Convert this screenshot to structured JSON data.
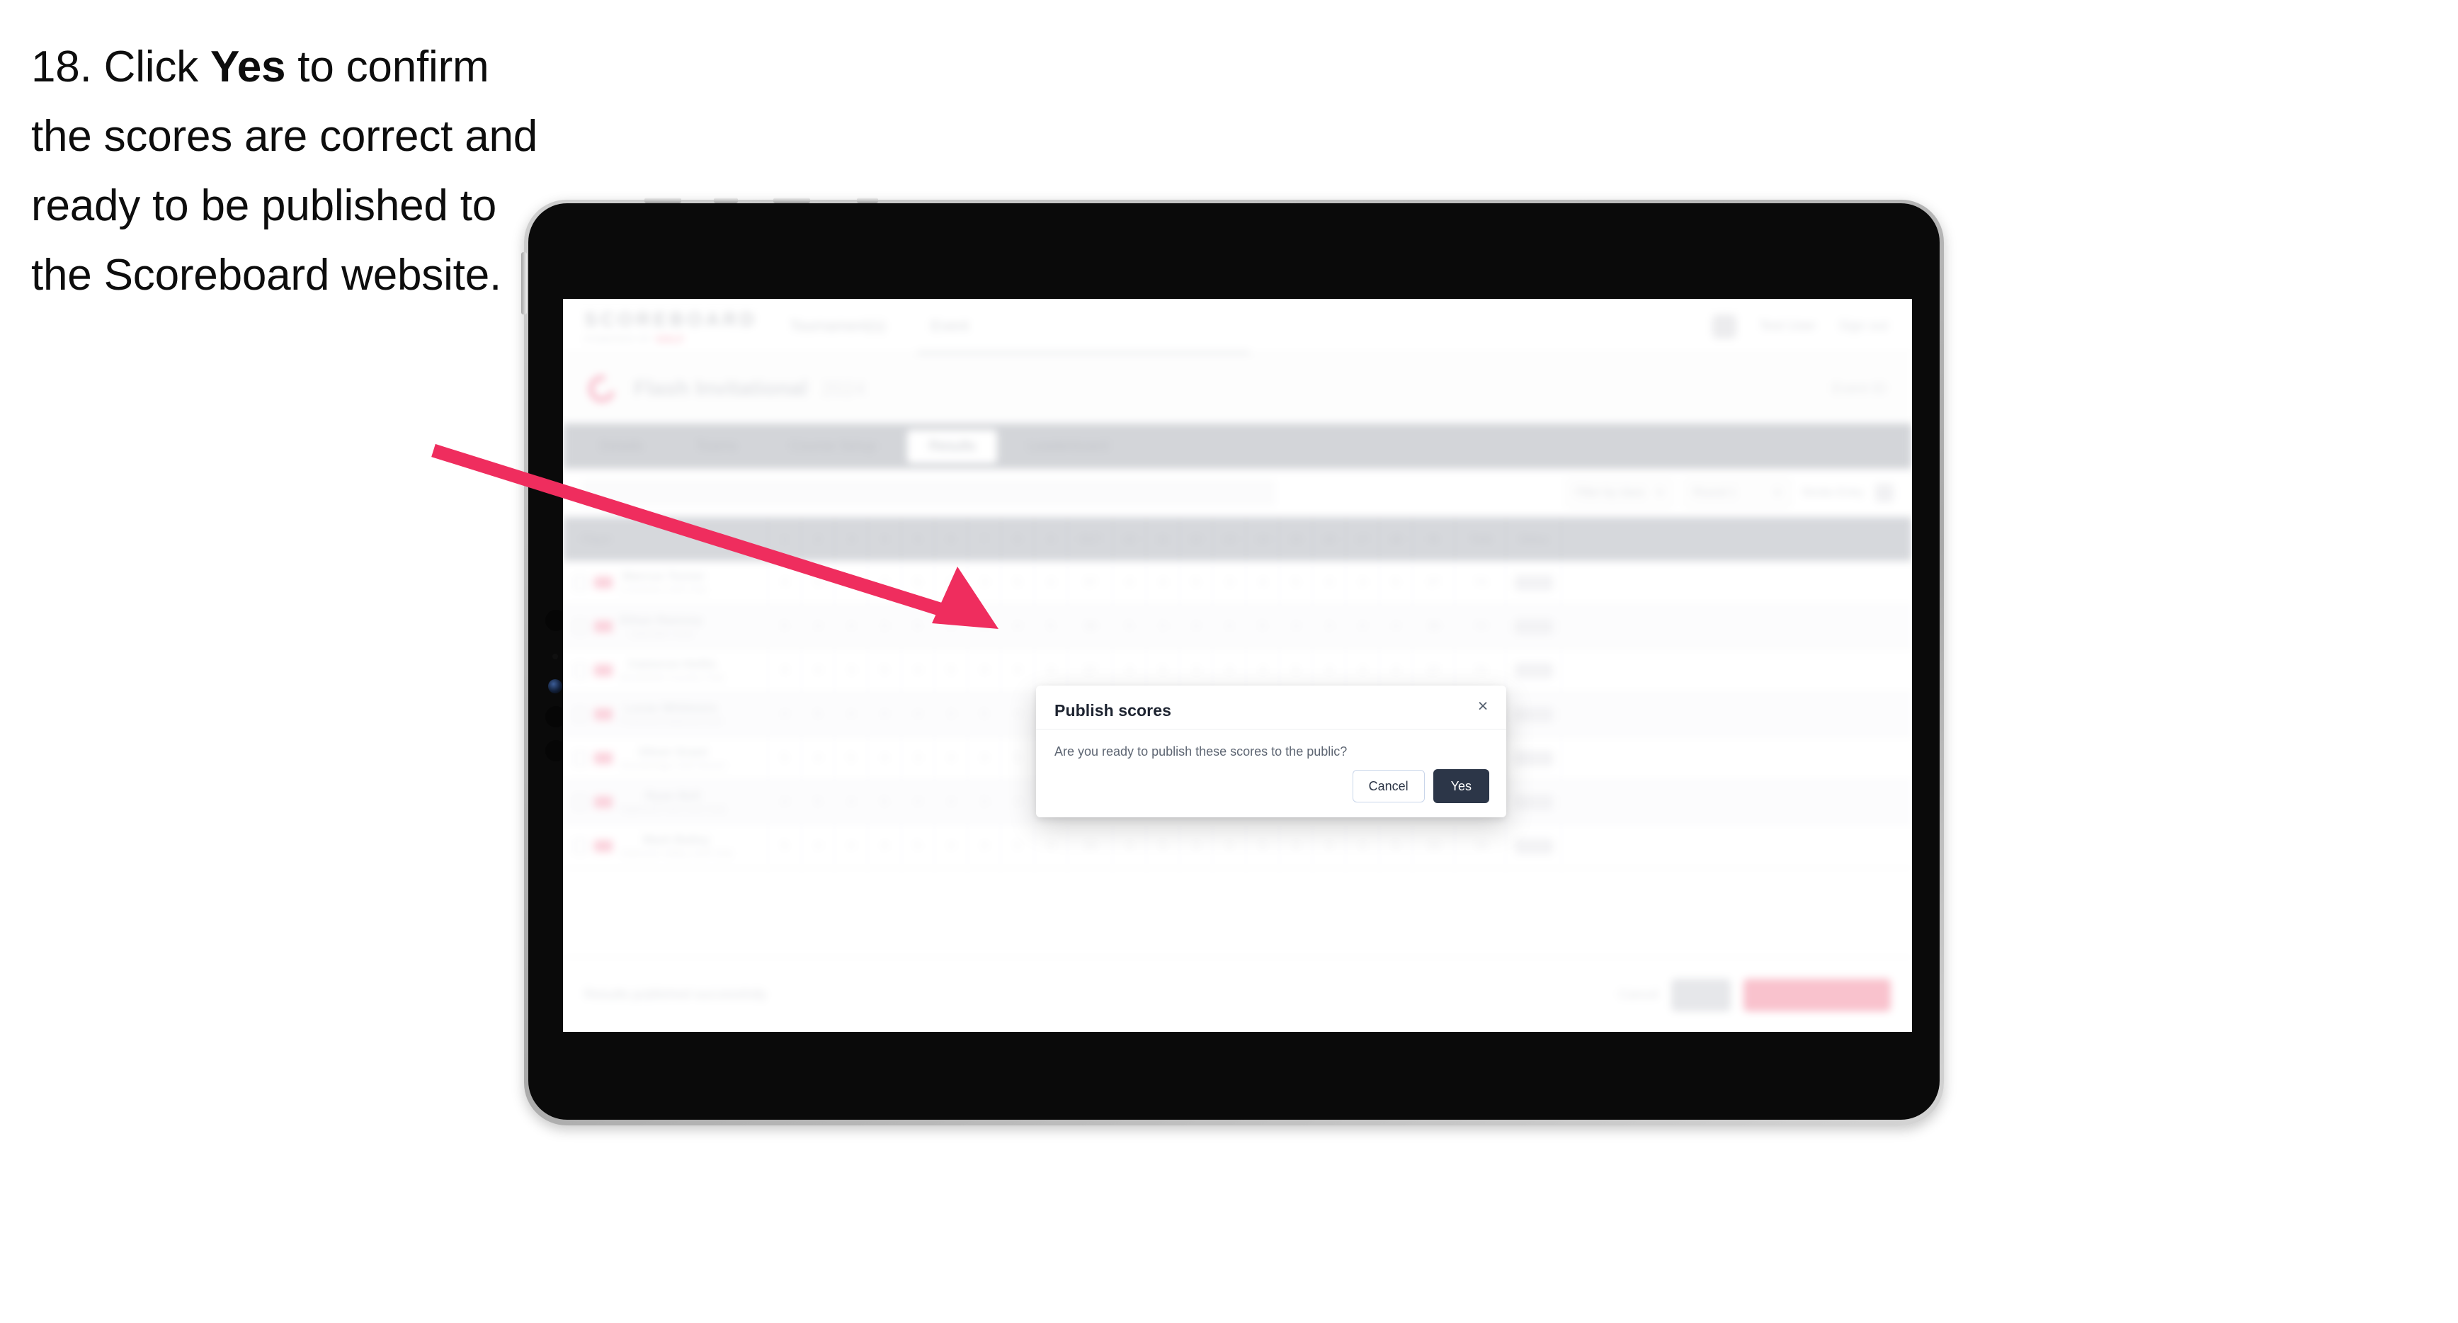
{
  "instruction": {
    "prefix": "18. Click ",
    "emphasis": "Yes",
    "suffix": " to confirm the scores are correct and ready to be published to the Scoreboard website."
  },
  "annotation": {
    "arrow_color": "#ef2d5e",
    "arrow_name": "pointer-arrow"
  },
  "modal": {
    "title": "Publish scores",
    "close_icon": "×",
    "body_text": "Are you ready to publish these scores to the public?",
    "cancel_label": "Cancel",
    "confirm_label": "Yes",
    "confirm_bg": "#2c3648",
    "cancel_border": "#c9d6ea"
  },
  "app": {
    "brand": {
      "word": "SCOREBOARD",
      "sub": "POWERED BY",
      "sub_accent": "GOLF"
    },
    "nav": [
      {
        "label": "Tournament(s)"
      },
      {
        "label": "Event"
      }
    ],
    "header_right": {
      "icon": "bell-icon",
      "user": "Test User",
      "signout": "Sign out"
    },
    "page_title": {
      "icon": "tournament-icon",
      "text": "Flash Invitational",
      "meta": "2024",
      "right": "Event ID"
    },
    "tabs": [
      {
        "label": "Details",
        "active": false
      },
      {
        "label": "Teams",
        "active": false
      },
      {
        "label": "Course Setup",
        "active": false
      },
      {
        "label": "Results",
        "active": true
      },
      {
        "label": "Leaderboard",
        "active": false
      }
    ],
    "toolbar": {
      "search_placeholder": "Search",
      "select_1": "Filter by class",
      "select_2": "Round 1",
      "label": "Stroke Entry",
      "icon": "settings-icon"
    },
    "table": {
      "headers": {
        "player": "Player",
        "holes": [
          "1",
          "2",
          "3",
          "4",
          "5",
          "6",
          "7",
          "8",
          "9"
        ],
        "out": "OUT",
        "holes_back": [
          "10",
          "11",
          "12",
          "13",
          "14",
          "15",
          "16",
          "17",
          "18"
        ],
        "in": "IN",
        "total": "Total",
        "status": "Status"
      },
      "rows": [
        {
          "name": "Marcus Turner",
          "club": "Crestview Golf Club",
          "scores": [
            "4",
            "5",
            "3",
            "4",
            "5",
            "4",
            "3",
            "5",
            "4"
          ],
          "out": "37",
          "back": [
            "4",
            "4",
            "5",
            "3",
            "4",
            "5",
            "4",
            "3",
            "5"
          ],
          "in": "37",
          "total": "74",
          "points": "Posted",
          "status": "Final"
        },
        {
          "name": "Ethan Ramsey",
          "club": "Lakeside Links",
          "scores": [
            "5",
            "4",
            "4",
            "3",
            "5",
            "4",
            "4",
            "4",
            "5"
          ],
          "out": "38",
          "back": [
            "5",
            "3",
            "4",
            "4",
            "5",
            "4",
            "3",
            "4",
            "4"
          ],
          "in": "36",
          "total": "74",
          "points": "Posted",
          "status": "Final"
        },
        {
          "name": "Cameron Hollis",
          "club": "Brookfield Country Club",
          "scores": [
            "4",
            "4",
            "3",
            "5",
            "4",
            "5",
            "4",
            "4",
            "4"
          ],
          "out": "37",
          "back": [
            "4",
            "5",
            "3",
            "4",
            "4",
            "5",
            "4",
            "4",
            "4"
          ],
          "in": "37",
          "total": "74",
          "points": "Posted",
          "status": "Final"
        },
        {
          "name": "Lucas Whitmore",
          "club": "Pinehurst National Golf",
          "scores": [
            "4",
            "5",
            "4",
            "4",
            "4",
            "3",
            "5",
            "4",
            "5"
          ],
          "out": "38",
          "back": [
            "4",
            "4",
            "4",
            "5",
            "3",
            "4",
            "5",
            "4",
            "4"
          ],
          "in": "37",
          "total": "75",
          "points": "Posted",
          "status": "Final"
        },
        {
          "name": "Oliver Grant",
          "club": "Stonebridge Golf Resort",
          "scores": [
            "5",
            "4",
            "5",
            "4",
            "3",
            "4",
            "4",
            "5",
            "4"
          ],
          "out": "38",
          "back": [
            "5",
            "4",
            "3",
            "4",
            "4",
            "4",
            "5",
            "4",
            "4"
          ],
          "in": "37",
          "total": "75",
          "points": "Posted",
          "status": "Final"
        },
        {
          "name": "Ryan Bell",
          "club": "Highland Park Golf Club",
          "scores": [
            "4",
            "5",
            "4",
            "5",
            "4",
            "4",
            "3",
            "4",
            "5"
          ],
          "out": "38",
          "back": [
            "4",
            "4",
            "5",
            "4",
            "4",
            "3",
            "5",
            "4",
            "5"
          ],
          "in": "38",
          "total": "76",
          "points": "Posted",
          "status": "Final"
        },
        {
          "name": "Mark Bailey",
          "club": "Oakmont Valley Golf Club",
          "scores": [
            "5",
            "4",
            "4",
            "4",
            "5",
            "4",
            "4",
            "5",
            "4"
          ],
          "out": "39",
          "back": [
            "4",
            "5",
            "4",
            "4",
            "5",
            "4",
            "4",
            "4",
            "5"
          ],
          "in": "39",
          "total": "78",
          "points": "Posted",
          "status": "Final"
        }
      ]
    },
    "footer": {
      "note": "Results published successfully",
      "link": "Cancel",
      "save_label": "Save",
      "publish_label": "Publish to Scoreboard"
    }
  }
}
